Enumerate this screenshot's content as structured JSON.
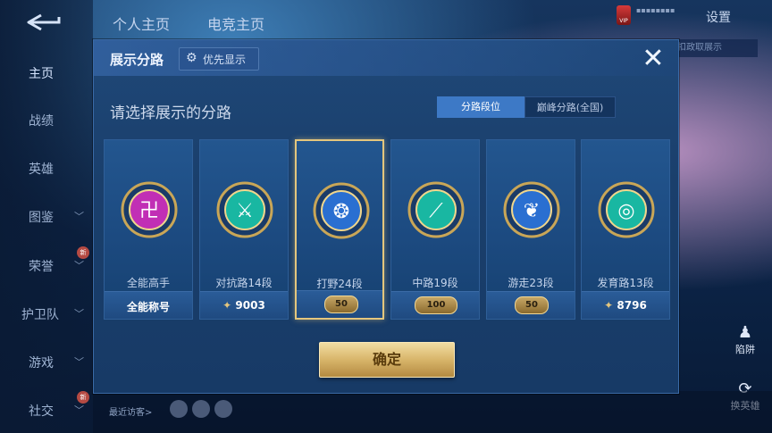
{
  "back_icon": "back-arrow-icon",
  "leftnav": {
    "items": [
      {
        "label": "主页",
        "active": true,
        "chevron": false,
        "new_badge": false
      },
      {
        "label": "战绩",
        "active": false,
        "chevron": false,
        "new_badge": false
      },
      {
        "label": "英雄",
        "active": false,
        "chevron": false,
        "new_badge": false
      },
      {
        "label": "图鉴",
        "active": false,
        "chevron": true,
        "new_badge": false
      },
      {
        "label": "荣誉",
        "active": false,
        "chevron": true,
        "new_badge": true,
        "badge_text": "新"
      },
      {
        "label": "护卫队",
        "active": false,
        "chevron": true,
        "new_badge": false
      },
      {
        "label": "游戏",
        "active": false,
        "chevron": true,
        "new_badge": false
      },
      {
        "label": "社交",
        "active": false,
        "chevron": true,
        "new_badge": true,
        "badge_text": "新"
      }
    ]
  },
  "header": {
    "tab_personal": "个人主页",
    "tab_second": "电竞主页",
    "settings_label": "设置",
    "vip_label": "VIP",
    "side_strip": "扣政取展示",
    "right_buttons": [
      "陷阱",
      "换英雄"
    ]
  },
  "bottom": {
    "visitor_label": "最近访客>"
  },
  "dialog": {
    "title": "展示分路",
    "priority_label": "优先显示",
    "close_icon": "close-icon",
    "subtitle": "请选择展示的分路",
    "segment": {
      "options": [
        "分路段位",
        "巅峰分路(全国)"
      ],
      "selected": "分路段位"
    },
    "cards": [
      {
        "name": "全能高手",
        "foot_text": "全能称号",
        "foot_type": "title",
        "emblem": "all-round-emblem-icon",
        "color": "#c12fb5",
        "selected": false
      },
      {
        "name": "对抗路14段",
        "foot_text": "9003",
        "foot_type": "score",
        "emblem": "clash-lane-emblem-icon",
        "color": "#19b7a2",
        "selected": false
      },
      {
        "name": "打野24段",
        "foot_text": "50",
        "foot_type": "badge",
        "emblem": "jungle-emblem-icon",
        "color": "#2a6fd1",
        "selected": true
      },
      {
        "name": "中路19段",
        "foot_text": "100",
        "foot_type": "badge",
        "emblem": "mid-lane-emblem-icon",
        "color": "#19b7a2",
        "selected": false
      },
      {
        "name": "游走23段",
        "foot_text": "50",
        "foot_type": "badge",
        "emblem": "roam-emblem-icon",
        "color": "#2a6fd1",
        "selected": false
      },
      {
        "name": "发育路13段",
        "foot_text": "8796",
        "foot_type": "score",
        "emblem": "farm-lane-emblem-icon",
        "color": "#19b7a2",
        "selected": false
      }
    ],
    "confirm_label": "确定"
  }
}
